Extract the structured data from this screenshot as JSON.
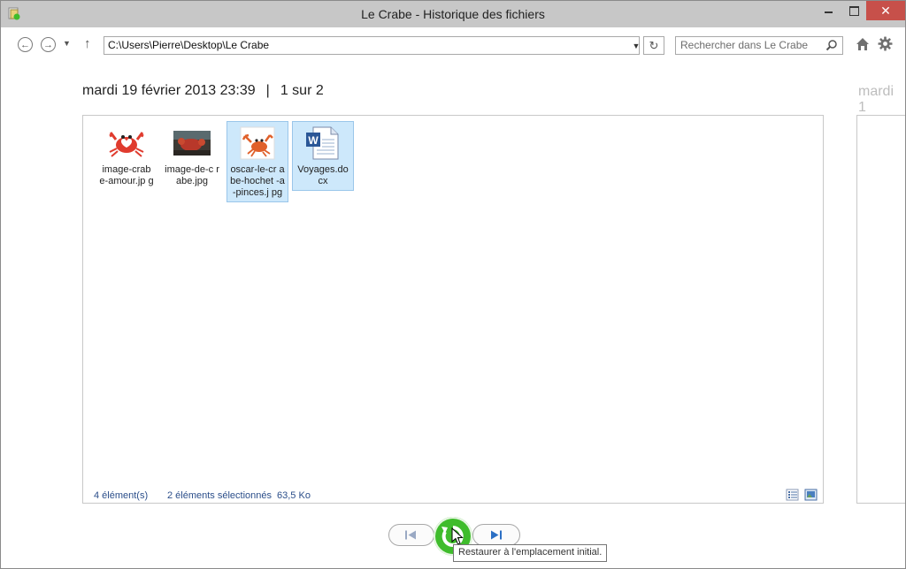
{
  "window": {
    "title": "Le Crabe - Historique des fichiers",
    "close_label": "✕"
  },
  "toolbar": {
    "address": "C:\\Users\\Pierre\\Desktop\\Le Crabe",
    "search_placeholder": "Rechercher dans Le Crabe"
  },
  "header": {
    "date": "mardi 19 février 2013 23:39",
    "separator": "|",
    "position": "1 sur 2",
    "next_date_preview": "mardi 1"
  },
  "files": [
    {
      "name": "image-crabe-amour.jpg",
      "label": "image-crab e-amour.jp g",
      "selected": false,
      "icon": "crab-heart-thumbnail"
    },
    {
      "name": "image-de-crabe.jpg",
      "label": "image-de-c rabe.jpg",
      "selected": false,
      "icon": "crab-photo-thumbnail"
    },
    {
      "name": "oscar-le-crabe-hochet-a-pinces.jpg",
      "label": "oscar-le-cr abe-hochet -a-pinces.j pg",
      "selected": true,
      "icon": "crab-drawing-thumbnail"
    },
    {
      "name": "Voyages.docx",
      "label": "Voyages.do cx",
      "selected": true,
      "icon": "word-document-icon"
    }
  ],
  "status": {
    "count": "4 élément(s)",
    "selection": "2 éléments sélectionnés",
    "size": "63,5 Ko"
  },
  "tooltip": {
    "restore": "Restaurer à l'emplacement initial."
  },
  "colors": {
    "restore_green": "#3fbc2c",
    "selection_bg": "#cde8fb",
    "close_red": "#c7504a"
  }
}
